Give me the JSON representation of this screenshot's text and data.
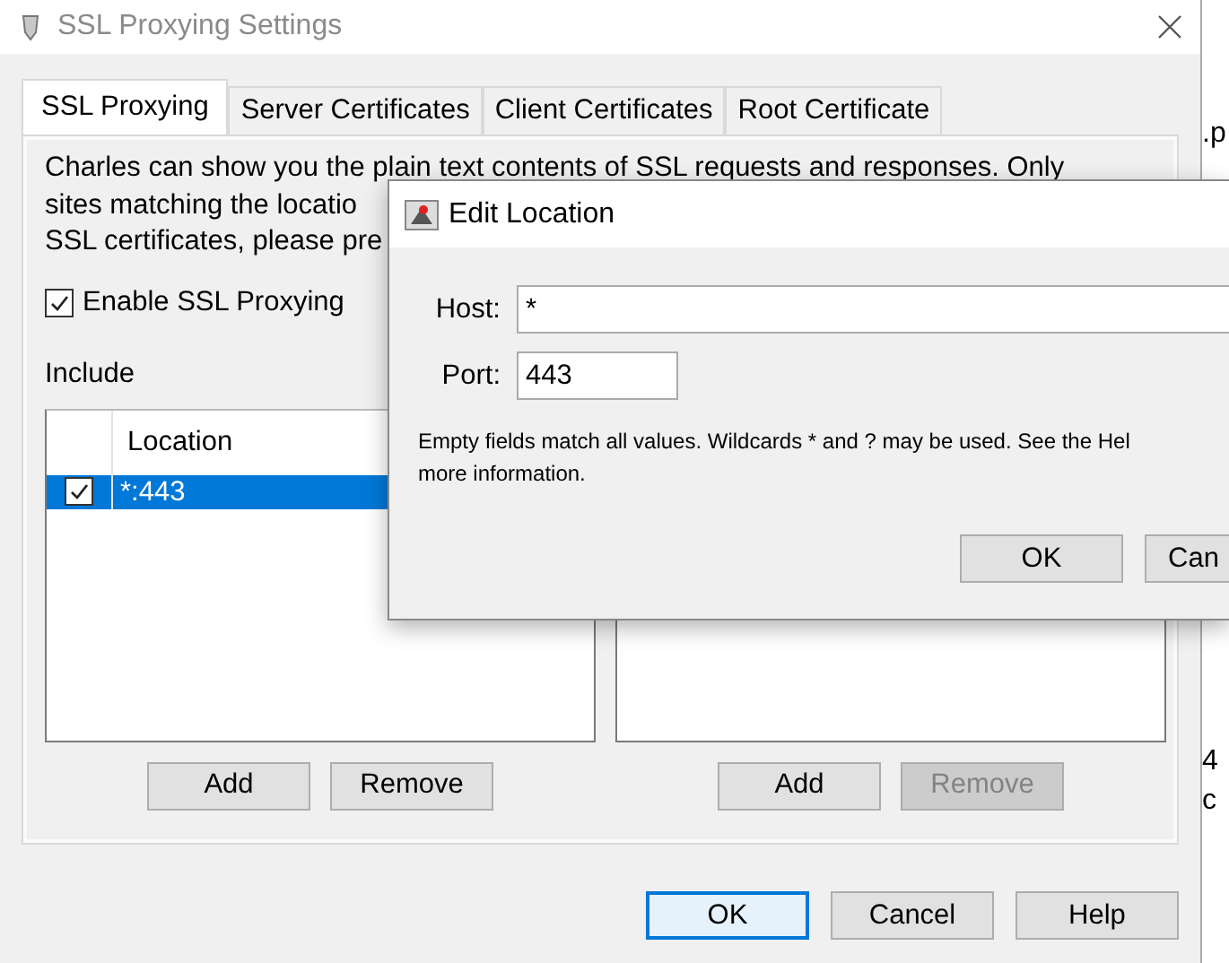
{
  "window": {
    "title": "SSL Proxying Settings"
  },
  "tabs": [
    {
      "label": "SSL Proxying",
      "selected": true
    },
    {
      "label": "Server Certificates",
      "selected": false
    },
    {
      "label": "Client Certificates",
      "selected": false
    },
    {
      "label": "Root Certificate",
      "selected": false
    }
  ],
  "description_lines": [
    "Charles can show you the plain text contents of SSL requests and responses. Only",
    "sites matching the locatio",
    "SSL certificates, please pre"
  ],
  "enable_ssl_proxying": {
    "label": "Enable SSL Proxying",
    "checked": true
  },
  "include": {
    "label": "Include",
    "columns": [
      "Location"
    ],
    "rows": [
      {
        "enabled": true,
        "location": "*:443",
        "selected": true
      }
    ],
    "buttons": [
      {
        "label": "Add",
        "disabled": false
      },
      {
        "label": "Remove",
        "disabled": false
      }
    ]
  },
  "exclude": {
    "buttons": [
      {
        "label": "Add",
        "disabled": false
      },
      {
        "label": "Remove",
        "disabled": true
      }
    ]
  },
  "buttons": [
    {
      "label": "OK",
      "default": true
    },
    {
      "label": "Cancel",
      "default": false
    },
    {
      "label": "Help",
      "default": false
    }
  ],
  "dialog": {
    "title": "Edit Location",
    "fields": [
      {
        "label": "Host:",
        "value": "*",
        "wide": true
      },
      {
        "label": "Port:",
        "value": "443",
        "wide": false
      }
    ],
    "note_lines": [
      "Empty fields match all values. Wildcards * and ? may be used. See the Hel",
      "more information."
    ],
    "buttons": [
      {
        "label": "OK"
      },
      {
        "label": "Can"
      }
    ]
  },
  "background_window": {
    "fragments": [
      ".p",
      "4",
      "c"
    ]
  }
}
